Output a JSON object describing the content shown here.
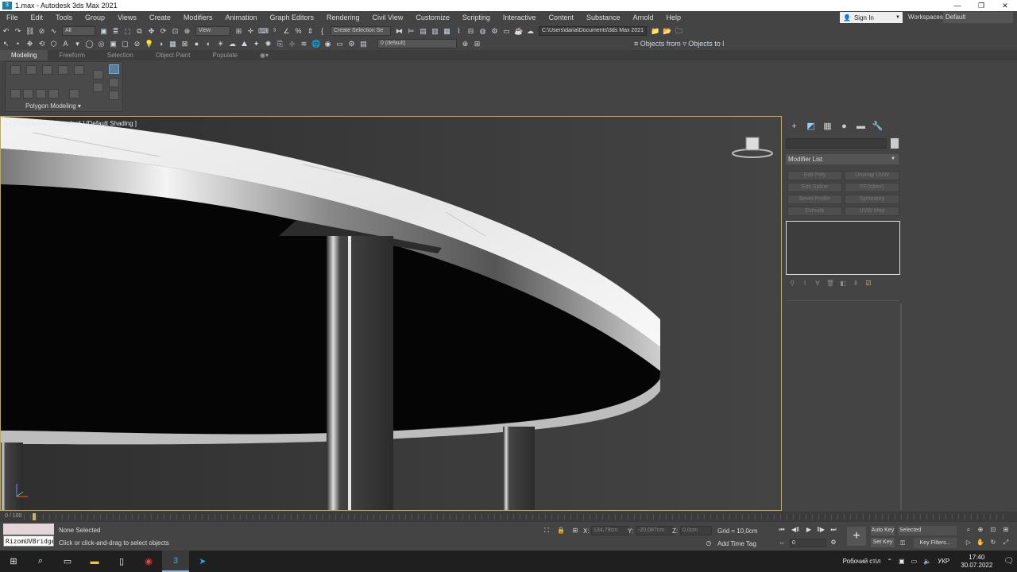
{
  "window": {
    "title": "1.max - Autodesk 3ds Max 2021",
    "app_icon": "3"
  },
  "window_controls": {
    "minimize": "—",
    "restore": "❐",
    "close": "✕"
  },
  "menu": [
    "File",
    "Edit",
    "Tools",
    "Group",
    "Views",
    "Create",
    "Modifiers",
    "Animation",
    "Graph Editors",
    "Rendering",
    "Civil View",
    "Customize",
    "Scripting",
    "Interactive",
    "Content",
    "Substance",
    "Arnold",
    "Help"
  ],
  "signin": {
    "label": "Sign In",
    "icon": "user-icon"
  },
  "workspaces": {
    "label": "Workspaces:",
    "value": "Default"
  },
  "toolbar1": {
    "selection_filter": "All",
    "ref_coord": "View",
    "named_selection": "Create Selection Se",
    "project_path": "C:\\Users\\daria\\Documents\\3ds Max 2021"
  },
  "toolbar2": {
    "layer": "0 (default)",
    "objects_text": "≡ Objects from ▿ Objects to l"
  },
  "ribbon": {
    "tabs": [
      "Modeling",
      "Freeform",
      "Selection",
      "Object Paint",
      "Populate"
    ],
    "active_tab": "Modeling",
    "panel_label": "Polygon Modeling ▾"
  },
  "viewport": {
    "label": "[+] [Perspective ] [Standard ] [Default Shading ]"
  },
  "command_panel": {
    "tabs": [
      "+",
      "◩",
      "▦",
      "●",
      "▬",
      "🔧"
    ],
    "modifier_list": "Modifier List",
    "modifier_buttons": [
      "Edit Poly",
      "Unwrap UVW",
      "Edit Spline",
      "FFD(box)",
      "Bevel Profile",
      "Symmetry",
      "Extrude",
      "UVW Map"
    ]
  },
  "timeline": {
    "frame_label": "0 / 100"
  },
  "status": {
    "maxscript_listener": "RizomUVBridge",
    "selection": "None Selected",
    "prompt": "Click or click-and-drag to select objects",
    "x_label": "X:",
    "x_value": "134,79cm",
    "y_label": "Y:",
    "y_value": "-20,087cm",
    "z_label": "Z:",
    "z_value": "0,0cm",
    "grid": "Grid = 10,0cm",
    "add_time_tag": "Add Time Tag",
    "current_frame": "0",
    "auto_key": "Auto Key",
    "set_key": "Set Key",
    "key_mode": "Selected",
    "key_filters": "Key Filters..."
  },
  "taskbar": {
    "search": "⌕",
    "desktop_label": "Робочий стіл",
    "language": "УКР",
    "time": "17:40",
    "date": "30.07.2022"
  }
}
